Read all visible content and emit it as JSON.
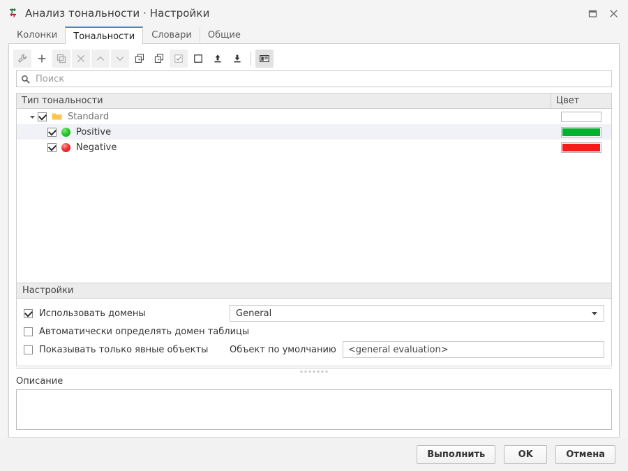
{
  "window": {
    "title": "Анализ тональности · Настройки",
    "app_icon": "sentiment-arrows-icon",
    "controls": {
      "maximize": "maximize-icon",
      "close": "close-icon"
    }
  },
  "tabs": [
    {
      "label": "Колонки",
      "active": false
    },
    {
      "label": "Тональности",
      "active": true
    },
    {
      "label": "Словари",
      "active": false
    },
    {
      "label": "Общие",
      "active": false
    }
  ],
  "toolbar": {
    "buttons": [
      {
        "name": "settings-wrench-icon",
        "state": "dim"
      },
      {
        "name": "add-icon",
        "state": "normal"
      },
      {
        "name": "duplicate-icon",
        "state": "dim"
      },
      {
        "name": "delete-icon",
        "state": "dim"
      },
      {
        "name": "move-up-icon",
        "state": "dim"
      },
      {
        "name": "move-down-icon",
        "state": "dim"
      },
      {
        "name": "expand-all-icon",
        "state": "normal"
      },
      {
        "name": "collapse-all-icon",
        "state": "normal"
      },
      {
        "name": "check-all-icon",
        "state": "dim"
      },
      {
        "name": "uncheck-all-icon",
        "state": "normal"
      },
      {
        "name": "import-icon",
        "state": "normal"
      },
      {
        "name": "export-icon",
        "state": "normal"
      },
      {
        "name": "show-details-icon",
        "state": "selected"
      }
    ]
  },
  "search": {
    "placeholder": "Поиск",
    "value": "",
    "icon": "search-icon"
  },
  "table": {
    "columns": [
      {
        "key": "type",
        "label": "Тип тональности"
      },
      {
        "key": "color",
        "label": "Цвет"
      }
    ],
    "rows": [
      {
        "label": "Standard",
        "level": 0,
        "expanded": true,
        "checked": true,
        "icon": "folder-icon",
        "selected": false,
        "color": "#ffffff"
      },
      {
        "label": "Positive",
        "level": 1,
        "expanded": null,
        "checked": true,
        "icon": "green-dot-icon",
        "selected": true,
        "color": "#00b22d"
      },
      {
        "label": "Negative",
        "level": 1,
        "expanded": null,
        "checked": true,
        "icon": "red-dot-icon",
        "selected": false,
        "color": "#f91a1a"
      }
    ]
  },
  "settings": {
    "title": "Настройки",
    "use_domains": {
      "label": "Использовать домены",
      "checked": true
    },
    "domain_combo": {
      "value": "General",
      "options": [
        "General"
      ]
    },
    "auto_detect": {
      "label": "Автоматически определять домен таблицы",
      "checked": false
    },
    "explicit_only": {
      "label": "Показывать только явные объекты",
      "checked": false
    },
    "default_object": {
      "label": "Объект по умолчанию",
      "value": "<general evaluation>"
    }
  },
  "description": {
    "label": "Описание",
    "value": ""
  },
  "buttons": [
    {
      "label": "Выполнить",
      "name": "execute-button"
    },
    {
      "label": "OK",
      "name": "ok-button"
    },
    {
      "label": "Отмена",
      "name": "cancel-button"
    }
  ],
  "colors": {
    "accent": "#3d8bd4",
    "positive": "#00b22d",
    "negative": "#f91a1a",
    "folder": "#ffc34d"
  }
}
